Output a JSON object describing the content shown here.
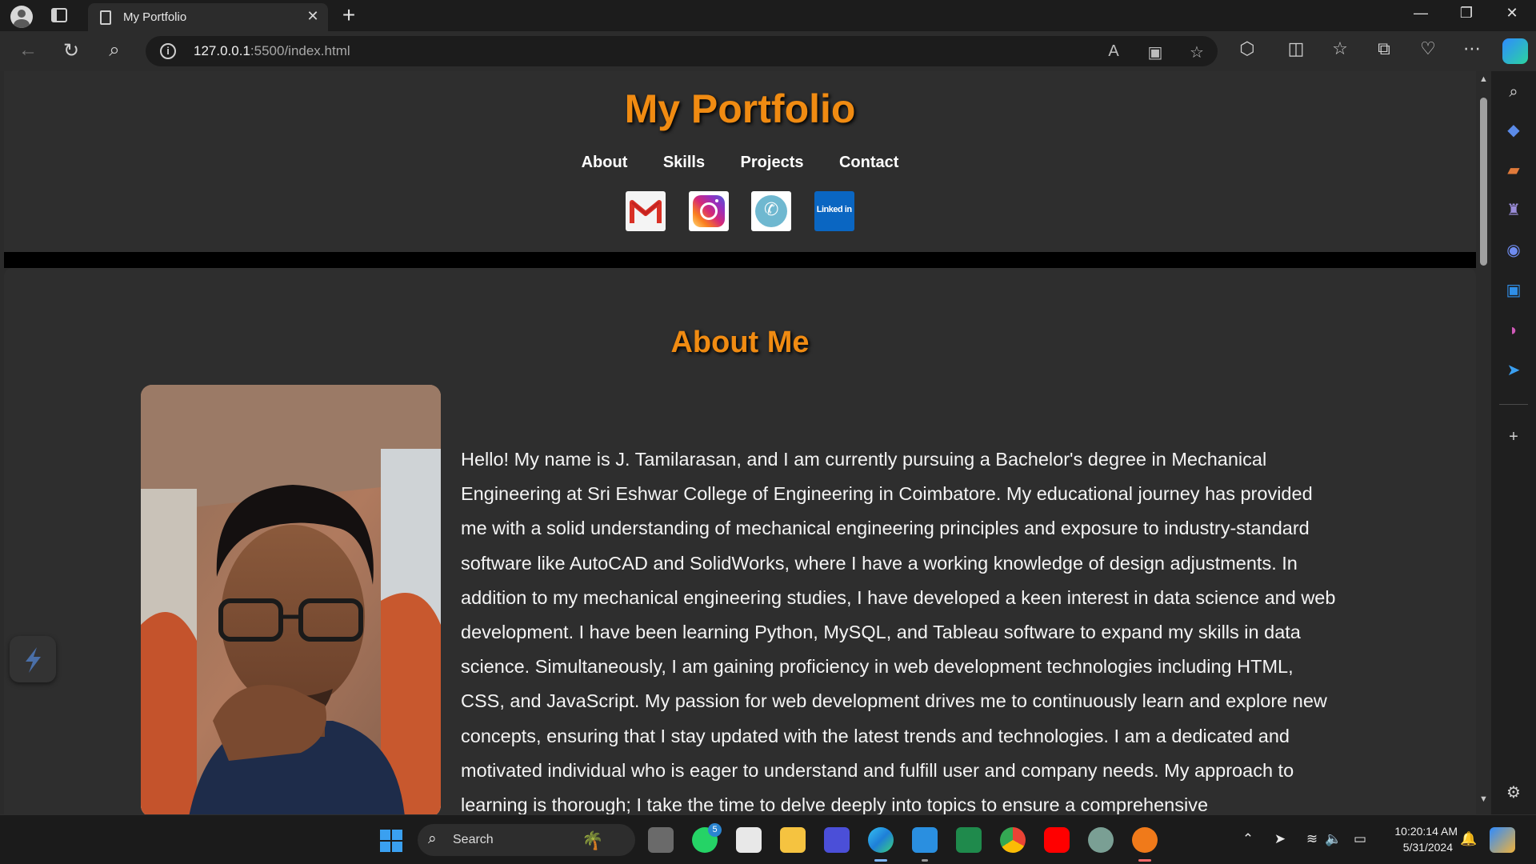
{
  "browser": {
    "tab": {
      "title": "My Portfolio"
    },
    "address": {
      "host": "127.0.0.1",
      "path": ":5500/index.html"
    }
  },
  "page": {
    "title": "My Portfolio",
    "nav": [
      "About",
      "Skills",
      "Projects",
      "Contact"
    ],
    "socials": {
      "linkedin_label": "Linked in"
    },
    "about": {
      "heading": "About Me",
      "body": "Hello! My name is J. Tamilarasan, and I am currently pursuing a Bachelor's degree in Mechanical Engineering at Sri Eshwar College of Engineering in Coimbatore. My educational journey has provided me with a solid understanding of mechanical engineering principles and exposure to industry-standard software like AutoCAD and SolidWorks, where I have a working knowledge of design adjustments. In addition to my mechanical engineering studies, I have developed a keen interest in data science and web development. I have been learning Python, MySQL, and Tableau software to expand my skills in data science. Simultaneously, I am gaining proficiency in web development technologies including HTML, CSS, and JavaScript. My passion for web development drives me to continuously learn and explore new concepts, ensuring that I stay updated with the latest trends and technologies. I am a dedicated and motivated individual who is eager to understand and fulfill user and company needs. My approach to learning is thorough; I take the time to delve deeply into topics to ensure a comprehensive"
    }
  },
  "taskbar": {
    "search_label": "Search",
    "whatsapp_badge": "5",
    "clock": {
      "time": "10:20:14 AM",
      "date": "5/31/2024"
    }
  },
  "colors": {
    "accent_orange": "#f08b12",
    "page_bg": "#2e2e2e",
    "divider": "#000000"
  }
}
